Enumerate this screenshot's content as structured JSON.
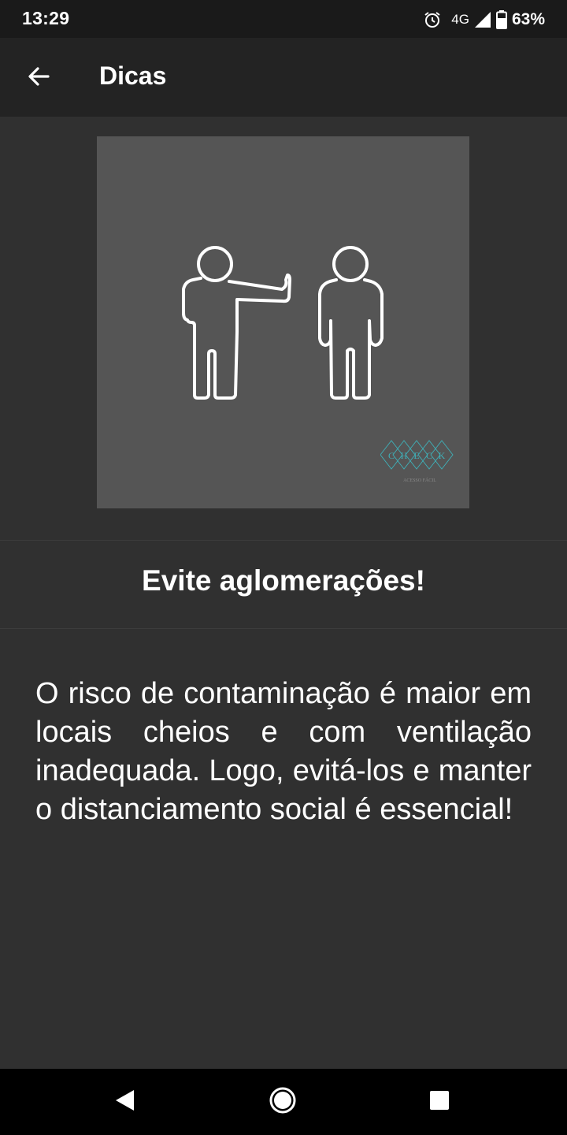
{
  "status_bar": {
    "time": "13:29",
    "network": "4G",
    "battery": "63%",
    "icons": [
      "alarm-icon",
      "signal-icon",
      "battery-icon"
    ]
  },
  "app_bar": {
    "title": "Dicas",
    "back_icon": "arrow-back-icon"
  },
  "tip": {
    "image": {
      "description_icon": "people-distancing-illustration",
      "logo": {
        "letters": [
          "C",
          "H",
          "E",
          "C",
          "K"
        ],
        "caption": "ACESSO FÁCIL"
      }
    },
    "heading": "Evite aglomerações!",
    "body": "O risco de contaminação é maior em locais cheios e com ventilação inadequada. Logo, evitá-los e manter o distanciamento social é essencial!"
  },
  "nav_bar": {
    "icons": [
      "back-triangle-icon",
      "home-circle-icon",
      "recents-square-icon"
    ]
  },
  "colors": {
    "background": "#303030",
    "app_bar": "#232323",
    "status_bar": "#1a1a1a",
    "image_bg": "#555555",
    "logo_accent": "#3fb0b8"
  }
}
